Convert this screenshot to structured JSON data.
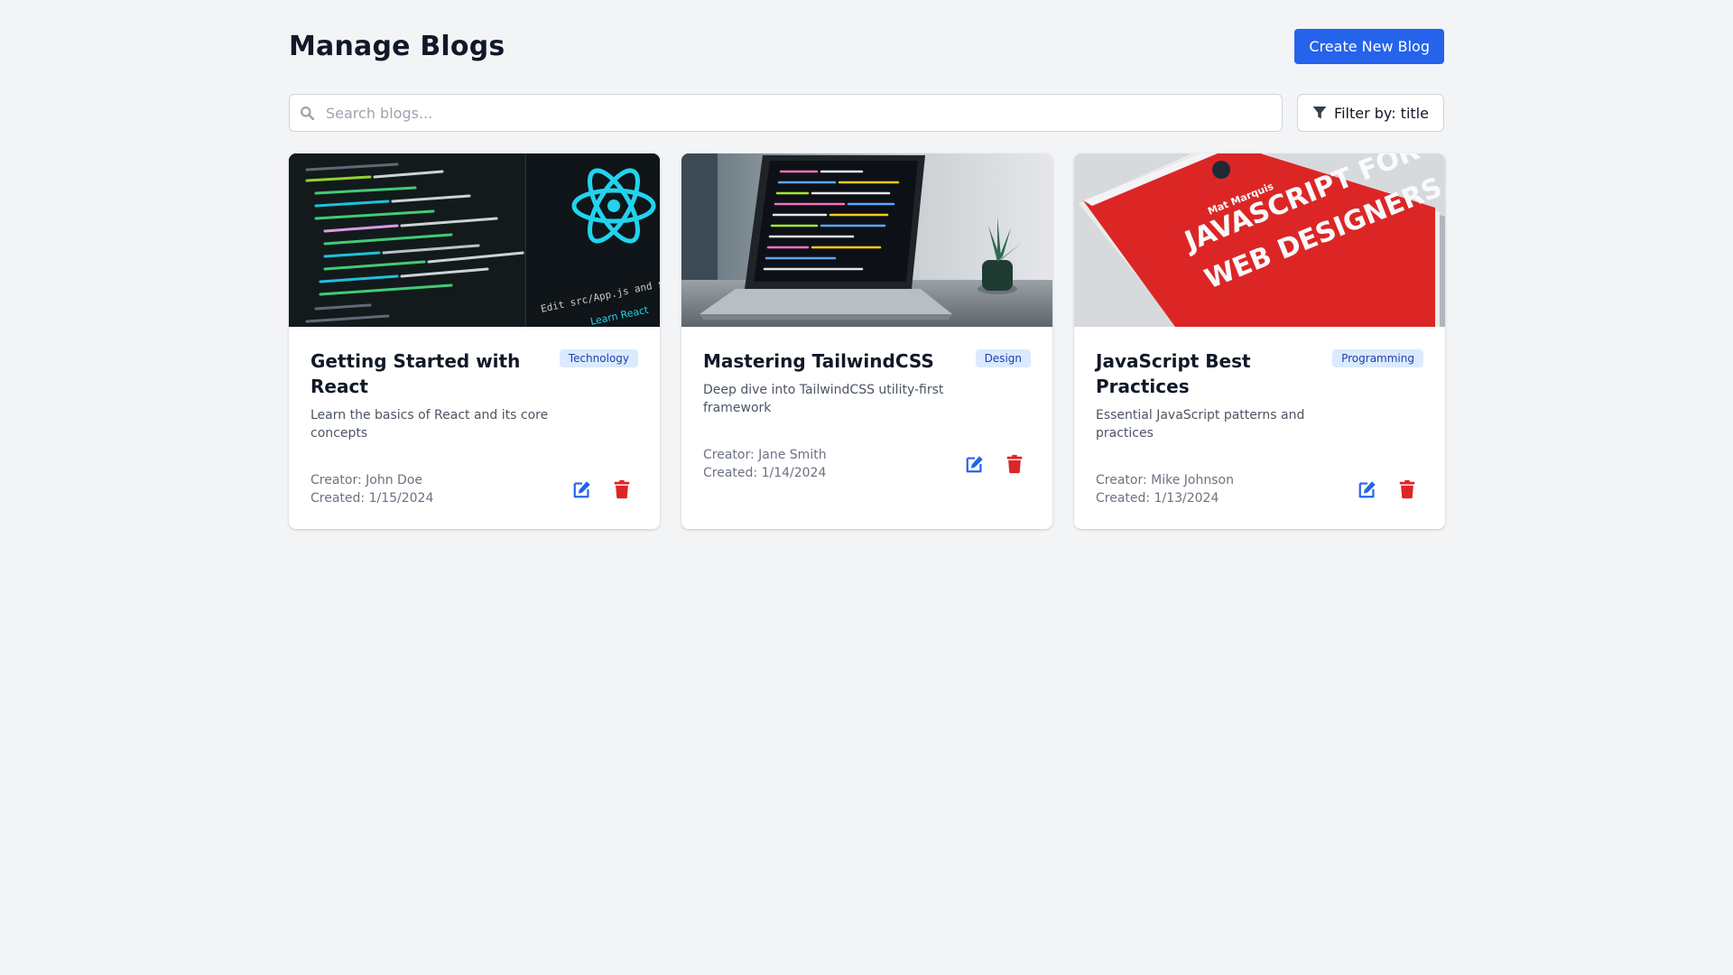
{
  "header": {
    "title": "Manage Blogs",
    "create_label": "Create New Blog"
  },
  "search": {
    "placeholder": "Search blogs...",
    "value": ""
  },
  "filter": {
    "label": "Filter by: title"
  },
  "colors": {
    "primary": "#2563eb",
    "danger": "#dc2626",
    "badge_bg": "#dbeafe",
    "badge_text": "#1e40af"
  },
  "blogs": [
    {
      "title": "Getting Started with React",
      "category": "Technology",
      "description": "Learn the basics of React and its core concepts",
      "creator": "Creator: John Doe",
      "created": "Created: 1/15/2024",
      "image": "react-code-photo"
    },
    {
      "title": "Mastering TailwindCSS",
      "category": "Design",
      "description": "Deep dive into TailwindCSS utility-first framework",
      "creator": "Creator: Jane Smith",
      "created": "Created: 1/14/2024",
      "image": "laptop-code-photo"
    },
    {
      "title": "JavaScript Best Practices",
      "category": "Programming",
      "description": "Essential JavaScript patterns and practices",
      "creator": "Creator: Mike Johnson",
      "created": "Created: 1/13/2024",
      "image": "javascript-book-photo"
    }
  ],
  "icons": {
    "search": "search-icon",
    "filter": "filter-icon",
    "edit": "edit-icon",
    "delete": "trash-icon"
  }
}
